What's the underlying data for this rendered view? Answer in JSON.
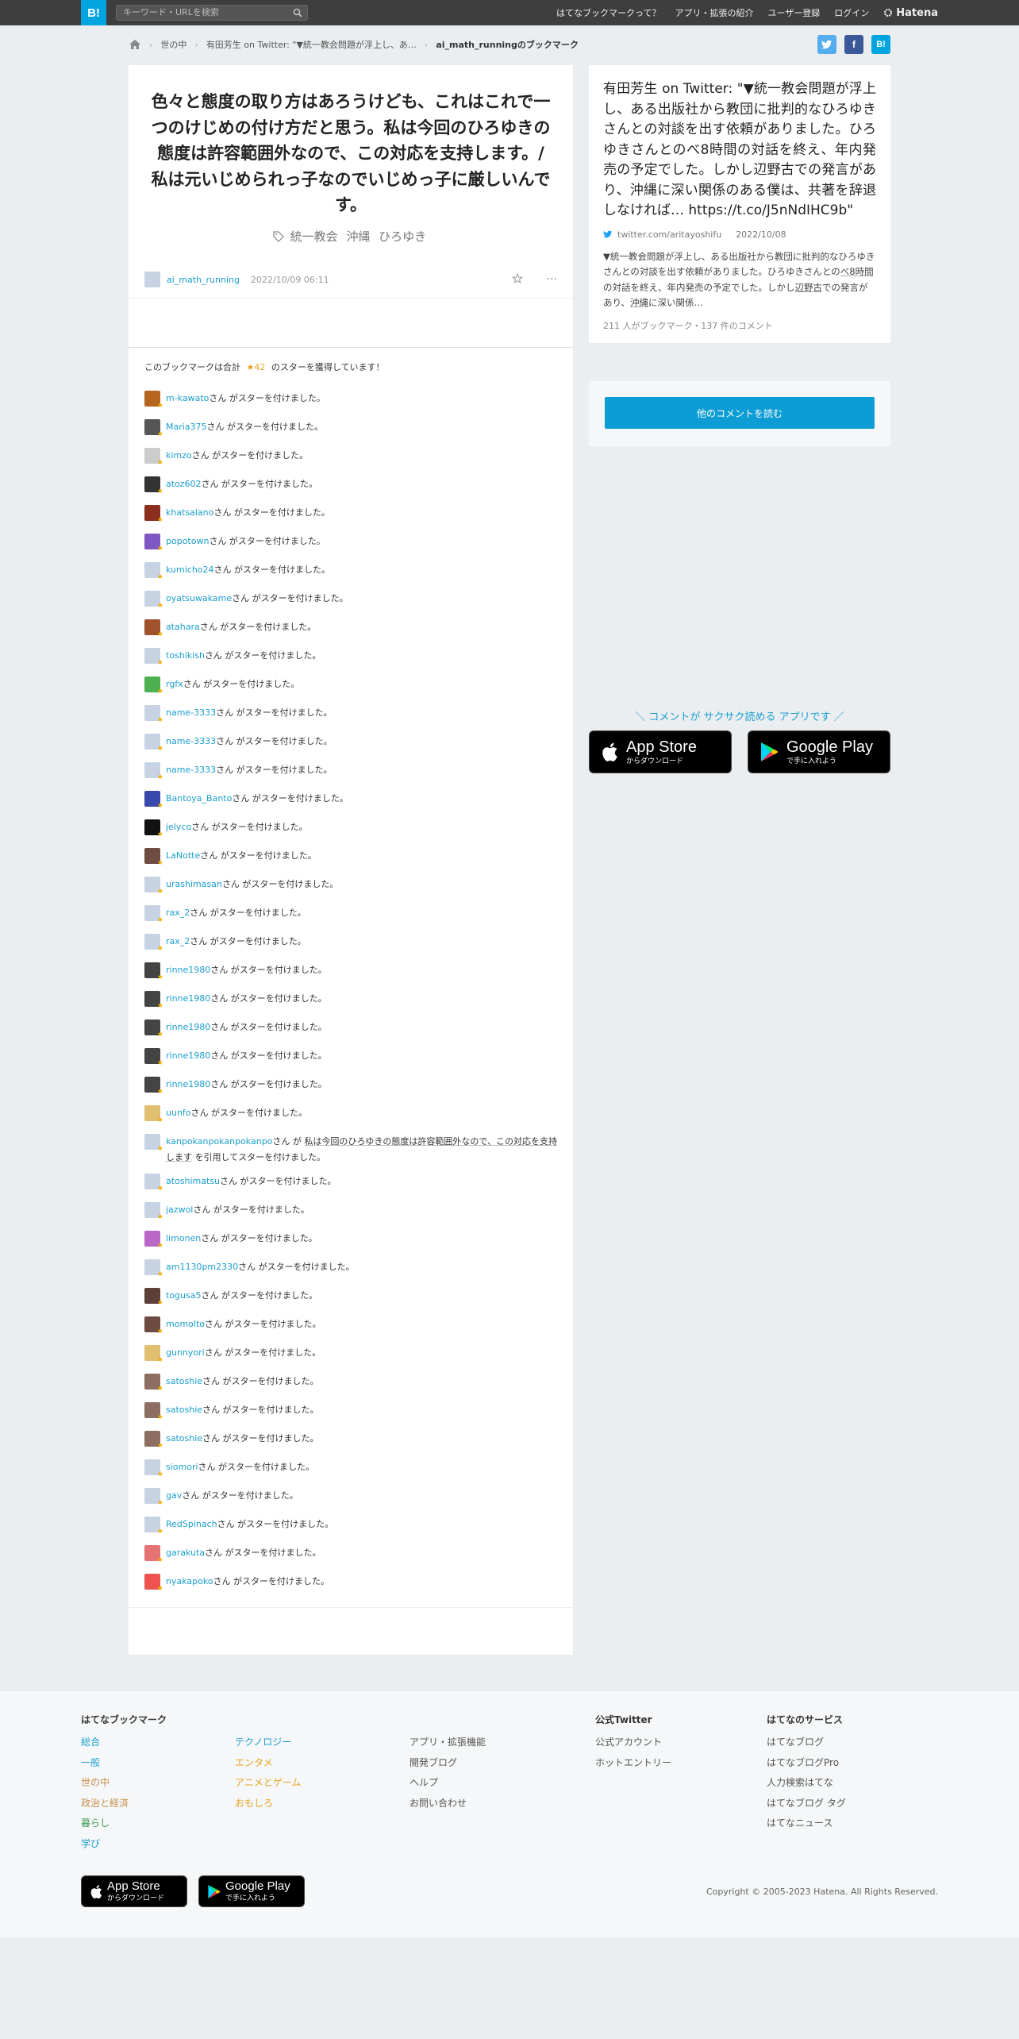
{
  "topbar": {
    "logo": "B!",
    "search_placeholder": "キーワード・URLを検索",
    "nav": [
      "はてなブックマークって？",
      "アプリ・拡張の紹介",
      "ユーザー登録",
      "ログイン"
    ],
    "brand": "Hatena"
  },
  "breadcrumb": [
    "世の中",
    "有田芳生 on Twitter: \"▼統一教会問題が浮上し、あ…",
    "ai_math_runningのブックマーク"
  ],
  "social": {
    "twitter": "t",
    "facebook": "f",
    "hatena": "B!"
  },
  "bookmark": {
    "comment": "色々と態度の取り方はあろうけども、これはこれで一つのけじめの付け方だと思う。私は今回のひろゆきの態度は許容範囲外なので、この対応を支持します。/ 私は元いじめられっ子なのでいじめっ子に厳しいんです。",
    "tags": [
      "統一教会",
      "沖縄",
      "ひろゆき"
    ],
    "user": "ai_math_running",
    "date": "2022/10/09 06:11",
    "more": "···"
  },
  "stars": {
    "prefix": "このブックマークは合計",
    "count": "★42",
    "suffix": "のスターを獲得しています！",
    "action": "さん がスターを付けました。",
    "quote_prefix": "さん が",
    "quote_text": "私は今回のひろゆきの態度は許容範囲外なので、この対応を支持します",
    "quote_suffix": "を引用してスターを付けました。",
    "users": [
      "m-kawato",
      "Maria375",
      "kimzo",
      "atoz602",
      "khatsalano",
      "popotown",
      "kumicho24",
      "oyatsuwakame",
      "atahara",
      "toshikish",
      "rgfx",
      "name-3333",
      "name-3333",
      "name-3333",
      "Bantoya_Banto",
      "jelyco",
      "LaNotte",
      "urashimasan",
      "rax_2",
      "rax_2",
      "rinne1980",
      "rinne1980",
      "rinne1980",
      "rinne1980",
      "rinne1980",
      "uunfo",
      "kanpokanpokanpokanpo",
      "atoshimatsu",
      "jazwol",
      "limonen",
      "am1130pm2330",
      "togusa5",
      "momolto",
      "gunnyori",
      "satoshie",
      "satoshie",
      "satoshie",
      "siomori",
      "gav",
      "RedSpinach",
      "garakuta",
      "nyakapoko"
    ],
    "avatar_colors": [
      "#b5651d",
      "#555",
      "#ccc",
      "#333",
      "#8b2f1e",
      "#7e57c2",
      "#c7d3e3",
      "#c7d3e3",
      "#a0522d",
      "#c7d3e3",
      "#4caf50",
      "#c7d3e3",
      "#c7d3e3",
      "#c7d3e3",
      "#3949ab",
      "#111",
      "#6d4c41",
      "#c7d3e3",
      "#c7d3e3",
      "#c7d3e3",
      "#444",
      "#444",
      "#444",
      "#444",
      "#444",
      "#e0c070",
      "#c7d3e3",
      "#c7d3e3",
      "#c7d3e3",
      "#ba68c8",
      "#c7d3e3",
      "#5d4037",
      "#6d4c41",
      "#e0c070",
      "#8d6e63",
      "#8d6e63",
      "#8d6e63",
      "#c7d3e3",
      "#c7d3e3",
      "#c7d3e3",
      "#e57373",
      "#ef5350"
    ]
  },
  "entry": {
    "title": "有田芳生 on Twitter: \"▼統一教会問題が浮上し、ある出版社から教団に批判的なひろゆきさんとの対談を出す依頼がありました。ひろゆきさんとのべ8時間の対話を終え、年内発売の予定でした。しかし辺野古での発言があり、沖縄に深い関係のある僕は、共著を辞退しなければ… https://t.co/J5nNdIHC9b\"",
    "source": "twitter.com/aritayoshifu",
    "date": "2022/10/08",
    "desc_before": "▼統一教会問題が浮上し、ある出版社から教団に批判的なひろゆきさんとの対談を出す依頼がありました。ひろゆきさんとの",
    "desc_u1": "べ8時間",
    "desc_mid": "の対話を終え、年内発売の予定でした。しかし",
    "desc_u2": "辺野古",
    "desc_mid2": "での発言があり、",
    "desc_u3": "沖縄",
    "desc_after": "に深い関係...",
    "count": "211 人がブックマーク・137 件のコメント",
    "more_button": "他のコメントを読む"
  },
  "promo": {
    "text": "＼ コメントが サクサク読める アプリです ／",
    "appstore_small": "からダウンロード",
    "appstore_big": "App Store",
    "gplay_big": "Google Play",
    "gplay_small": "で手に入れよう"
  },
  "footer": {
    "col1_title": "はてなブックマーク",
    "col1": [
      {
        "t": "総合",
        "c": "#1a9ecf"
      },
      {
        "t": "一般",
        "c": "#1a9ecf"
      },
      {
        "t": "世の中",
        "c": "#c6904e"
      },
      {
        "t": "政治と経済",
        "c": "#c6904e"
      },
      {
        "t": "暮らし",
        "c": "#3e9a50"
      },
      {
        "t": "学び",
        "c": "#1a9ecf"
      }
    ],
    "col2": [
      {
        "t": "テクノロジー",
        "c": "#1a9ecf"
      },
      {
        "t": "エンタメ",
        "c": "#e5a321"
      },
      {
        "t": "アニメとゲーム",
        "c": "#e5a321"
      },
      {
        "t": "おもしろ",
        "c": "#e5a321"
      }
    ],
    "col3": [
      "アプリ・拡張機能",
      "開発ブログ",
      "ヘルプ",
      "お問い合わせ"
    ],
    "col4_title": "公式Twitter",
    "col4": [
      "公式アカウント",
      "ホットエントリー"
    ],
    "col5_title": "はてなのサービス",
    "col5": [
      "はてなブログ",
      "はてなブログPro",
      "人力検索はてな",
      "はてなブログ タグ",
      "はてなニュース"
    ],
    "copyright": "Copyright © 2005-2023 Hatena. All Rights Reserved."
  }
}
